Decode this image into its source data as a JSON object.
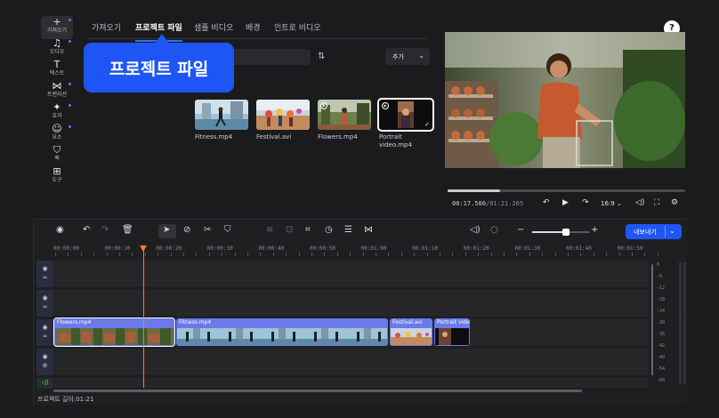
{
  "sidebar": {
    "items": [
      {
        "icon": "plus-icon",
        "glyph": "+",
        "label": "가져오기",
        "active": true,
        "dot": true
      },
      {
        "icon": "music-note-icon",
        "glyph": "♫",
        "label": "오디오",
        "dot": true
      },
      {
        "icon": "text-icon",
        "glyph": "T",
        "label": "텍스트",
        "dot": false
      },
      {
        "icon": "transition-icon",
        "glyph": "⋈",
        "label": "트랜지션",
        "dot": true
      },
      {
        "icon": "effects-icon",
        "glyph": "✦",
        "label": "효과",
        "dot": true
      },
      {
        "icon": "sticker-icon",
        "glyph": "☺",
        "label": "요소",
        "dot": true
      },
      {
        "icon": "bag-icon",
        "glyph": "⛉",
        "label": "팩",
        "dot": false
      },
      {
        "icon": "tools-icon",
        "glyph": "⊞",
        "label": "도구",
        "dot": false
      }
    ]
  },
  "tabs": [
    {
      "label": "가져오기",
      "active": false
    },
    {
      "label": "프로젝트 파일",
      "active": true
    },
    {
      "label": "샘플 비디오",
      "active": false
    },
    {
      "label": "배경",
      "active": false
    },
    {
      "label": "인트로 비디오",
      "active": false
    }
  ],
  "callout": {
    "text": "프로젝트 파일"
  },
  "library": {
    "add_label": "추가",
    "items": [
      {
        "name": "Fitness.mp4",
        "selected": false
      },
      {
        "name": "Festival.avi",
        "selected": false
      },
      {
        "name": "Flowers.mp4",
        "selected": false
      },
      {
        "name": "Portrait video.mp4",
        "selected": true
      }
    ]
  },
  "player": {
    "current_time": "00:17.500",
    "total_time": "/01:21.265",
    "progress": 0.22,
    "aspect_ratio": "16:9"
  },
  "timeline": {
    "export_label": "내보내기",
    "zoom_level": 0.6,
    "ruler": [
      "00:00:00",
      "00:00:10",
      "00:00:20",
      "00:00:30",
      "00:00:40",
      "00:00:50",
      "00:01:00",
      "00:01:10",
      "00:01:20",
      "00:01:30",
      "00:01:40",
      "00:01:50"
    ],
    "clips": [
      {
        "name": "Flowers.mp4",
        "selected": true
      },
      {
        "name": "Fitness.mp4",
        "selected": false
      },
      {
        "name": "Festival.avi",
        "selected": false
      },
      {
        "name": "Portrait vide",
        "selected": false
      }
    ],
    "meter_labels": [
      "0",
      "-6",
      "-12",
      "-18",
      "-24",
      "-30",
      "-36",
      "-42",
      "-48",
      "-54",
      "-60"
    ]
  },
  "status": {
    "project_length": "프로젝트 길이:01:21"
  },
  "colors": {
    "accent": "#1f56f5",
    "playhead": "#ff7a2b",
    "clip": "#6b7ae8"
  }
}
